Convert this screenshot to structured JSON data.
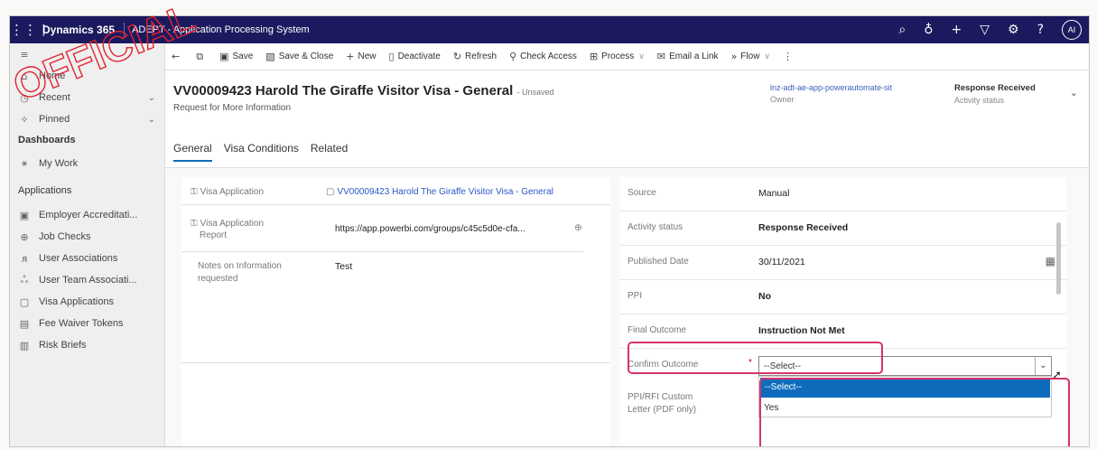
{
  "topbar": {
    "brand": "Dynamics 365",
    "app_name": "ADEPT - Application Processing System",
    "avatar": "AI"
  },
  "watermark": {
    "text": "OFFICIAL"
  },
  "sidebar": {
    "top_items": [
      {
        "label": "Home",
        "icon": "home-icon"
      },
      {
        "label": "Recent",
        "icon": "clock-icon"
      },
      {
        "label": "Pinned",
        "icon": "pin-icon"
      }
    ],
    "dashboards_heading": "Dashboards",
    "dashboard_items": [
      {
        "label": "My Work",
        "icon": "dashboard-icon"
      }
    ],
    "applications_heading": "Applications",
    "app_items": [
      {
        "label": "Employer Accreditati...",
        "icon": "building-icon"
      },
      {
        "label": "Job Checks",
        "icon": "briefcase-icon"
      },
      {
        "label": "User Associations",
        "icon": "user-link-icon"
      },
      {
        "label": "User Team Associati...",
        "icon": "team-icon"
      },
      {
        "label": "Visa Applications",
        "icon": "document-icon"
      },
      {
        "label": "Fee Waiver Tokens",
        "icon": "token-icon"
      },
      {
        "label": "Risk Briefs",
        "icon": "brief-icon"
      }
    ]
  },
  "command_bar": {
    "save": "Save",
    "save_close": "Save & Close",
    "new": "New",
    "deactivate": "Deactivate",
    "refresh": "Refresh",
    "check_access": "Check Access",
    "process": "Process",
    "email_link": "Email a Link",
    "flow": "Flow"
  },
  "header": {
    "title": "VV00009423 Harold The Giraffe Visitor Visa - General",
    "unsaved": "- Unsaved",
    "subtitle": "Request for More Information",
    "owner_value": "lnz-adt-ae-app-powerautomate-sit",
    "owner_label": "Owner",
    "status_value": "Response Received",
    "status_label": "Activity status",
    "tabs": [
      "General",
      "Visa Conditions",
      "Related"
    ]
  },
  "left_card": {
    "visa_application_label": "Visa Application",
    "visa_application_value": "VV00009423 Harold The Giraffe Visitor Visa - General",
    "report_label_1": "Visa Application",
    "report_label_2": "Report",
    "report_value": "https://app.powerbi.com/groups/c45c5d0e-cfa...",
    "notes_label_1": "Notes on Information",
    "notes_label_2": "requested",
    "notes_value": "Test"
  },
  "right_card": {
    "source_label": "Source",
    "source_value": "Manual",
    "activity_status_label": "Activity status",
    "activity_status_value": "Response Received",
    "published_label": "Published Date",
    "published_value": "30/11/2021",
    "ppi_label": "PPI",
    "ppi_value": "No",
    "final_outcome_label": "Final Outcome",
    "final_outcome_value": "Instruction Not Met",
    "confirm_label": "Confirm Outcome",
    "confirm_required": "*",
    "confirm_value": "--Select--",
    "confirm_options": [
      "--Select--",
      "Yes"
    ],
    "letter_label_1": "PPI/RFI Custom",
    "letter_label_2": "Letter (PDF only)"
  }
}
